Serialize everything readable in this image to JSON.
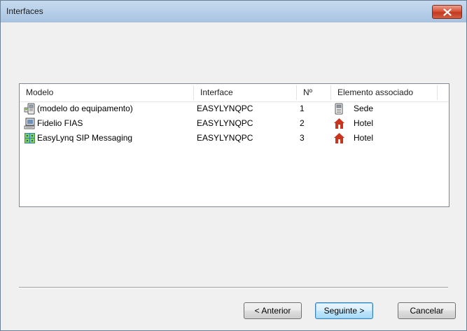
{
  "window": {
    "title": "Interfaces"
  },
  "listview": {
    "columns": [
      "Modelo",
      "Interface",
      "Nº",
      "Elemento associado"
    ],
    "rows": [
      {
        "model": "(modelo do equipamento)",
        "model_icon": "terminal-device-icon",
        "interface": "EASYLYNQPC",
        "number": "1",
        "element": "Sede",
        "element_icon": "server-icon"
      },
      {
        "model": "Fidelio FIAS",
        "model_icon": "computer-terminal-icon",
        "interface": "EASYLYNQPC",
        "number": "2",
        "element": "Hotel",
        "element_icon": "house-icon"
      },
      {
        "model": "EasyLynq SIP Messaging",
        "model_icon": "network-grid-icon",
        "interface": "EASYLYNQPC",
        "number": "3",
        "element": "Hotel",
        "element_icon": "house-icon"
      }
    ]
  },
  "buttons": {
    "back": "< Anterior",
    "next": "Seguinte >",
    "cancel": "Cancelar"
  },
  "colors": {
    "house_roof": "#c8341c",
    "titlebar": "#b9d1ea",
    "close": "#c13a21"
  }
}
